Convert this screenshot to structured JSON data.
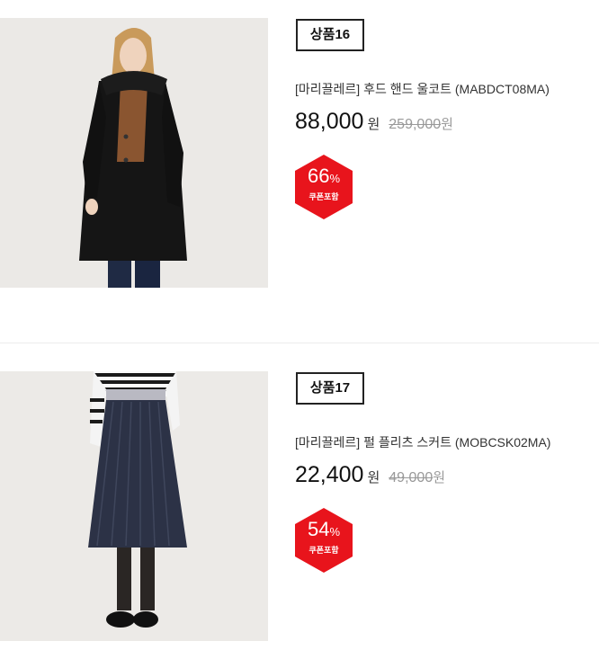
{
  "products": [
    {
      "badge": "상품16",
      "name": "[마리끌레르] 후드 핸드 울코트 (MABDCT08MA)",
      "price": "88,000",
      "price_unit": "원",
      "original_price": "259,000",
      "original_unit": "원",
      "discount": "66",
      "discount_unit": "%",
      "coupon_label": "쿠폰포함",
      "image_alt": "woman in black hooded wool coat"
    },
    {
      "badge": "상품17",
      "name": "[마리끌레르] 펄 플리츠 스커트 (MOBCSK02MA)",
      "price": "22,400",
      "price_unit": "원",
      "original_price": "49,000",
      "original_unit": "원",
      "discount": "54",
      "discount_unit": "%",
      "coupon_label": "쿠폰포함",
      "image_alt": "navy pleated skirt with striped sweater"
    }
  ],
  "colors": {
    "sale_badge": "#e8141c",
    "badge_border": "#222222",
    "divider": "#ececec"
  }
}
